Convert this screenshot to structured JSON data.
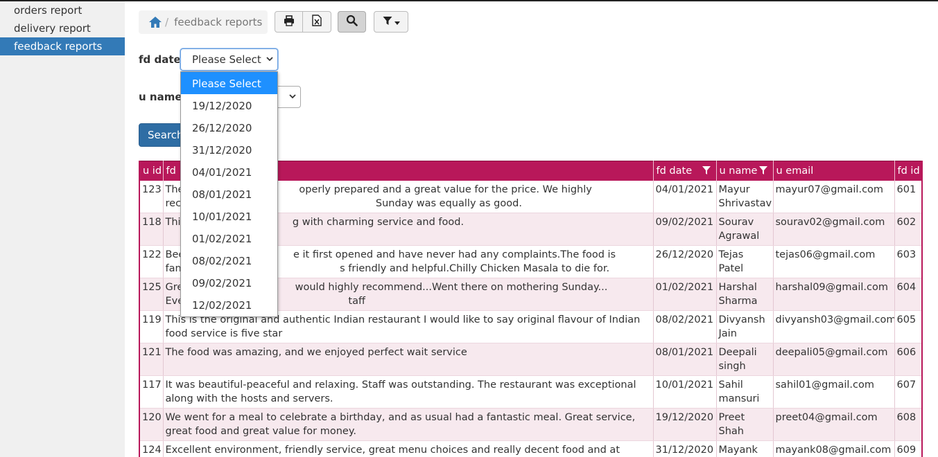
{
  "sidebar": {
    "items": [
      {
        "label": "orders report"
      },
      {
        "label": "delivery report"
      },
      {
        "label": "feedback reports"
      }
    ]
  },
  "breadcrumb": {
    "current": "feedback reports",
    "separator": "/"
  },
  "toolbar": {
    "print_icon": "print-icon",
    "excel_icon": "excel-icon",
    "search_icon": "search-icon",
    "filter_icon": "filter-icon"
  },
  "form": {
    "fd_date_label": "fd date",
    "fd_date_value": "Please Select",
    "u_name_label": "u name",
    "search_button": "Search"
  },
  "dropdown": {
    "options": [
      "Please Select",
      "19/12/2020",
      "26/12/2020",
      "31/12/2020",
      "04/01/2021",
      "08/01/2021",
      "10/01/2021",
      "01/02/2021",
      "08/02/2021",
      "09/02/2021",
      "12/02/2021"
    ]
  },
  "table": {
    "headers": {
      "uid": "u id",
      "fd": "fd",
      "fd_date": "fd date",
      "u_name": "u name",
      "u_email": "u email",
      "fd_id": "fd id"
    },
    "rows": [
      {
        "uid": "123",
        "fd": "The                                    operly prepared and a great value for the price. We highly recommend it. The                                    Sunday was equally as good.",
        "fd_date": "04/01/2021",
        "u_name": "Mayur Shrivastav",
        "u_email": "mayur07@gmail.com",
        "fd_id": "601"
      },
      {
        "uid": "118",
        "fd": "Thi                                   g with charming service and food.",
        "fd_date": "09/02/2021",
        "u_name": "Sourav Agrawal",
        "u_email": "sourav02@gmail.com",
        "fd_id": "602"
      },
      {
        "uid": "122",
        "fd": "Bee                                  e it first opened and have never had any complaints.The food is fantastic and                                  s friendly and helpful.Chilly Chicken Masala to die for.",
        "fd_date": "26/12/2020",
        "u_name": "Tejas Patel",
        "u_email": "tejas06@gmail.com",
        "fd_id": "603"
      },
      {
        "uid": "125",
        "fd": "Gre                                   would highly recommend...Went there on mothering Sunday... Everything per                                  taff",
        "fd_date": "01/02/2021",
        "u_name": "Harshal Sharma",
        "u_email": "harshal09@gmail.com",
        "fd_id": "604"
      },
      {
        "uid": "119",
        "fd": "This is the original and authentic Indian restaurant I would like to say original flavour of Indian food service is five star",
        "fd_date": "08/02/2021",
        "u_name": "Divyansh Jain",
        "u_email": "divyansh03@gmail.com",
        "fd_id": "605"
      },
      {
        "uid": "121",
        "fd": "The food was amazing, and we enjoyed perfect wait service",
        "fd_date": "08/01/2021",
        "u_name": "Deepali singh",
        "u_email": "deepali05@gmail.com",
        "fd_id": "606"
      },
      {
        "uid": "117",
        "fd": "It was beautiful-peaceful and relaxing. Staff was outstanding. The restaurant was exceptional along with the hosts and servers.",
        "fd_date": "10/01/2021",
        "u_name": "Sahil mansuri",
        "u_email": "sahil01@gmail.com",
        "fd_id": "607"
      },
      {
        "uid": "120",
        "fd": "We went for a meal to celebrate a birthday, and as usual had a fantastic meal. Great service, great food and great value for money.",
        "fd_date": "19/12/2020",
        "u_name": "Preet Shah",
        "u_email": "preet04@gmail.com",
        "fd_id": "608"
      },
      {
        "uid": "124",
        "fd": "Excellent environment, friendly service, great menu choices and really decent food and at",
        "fd_date": "31/12/2020",
        "u_name": "Mayank",
        "u_email": "mayank08@gmail.com",
        "fd_id": "609"
      }
    ]
  },
  "colors": {
    "accent": "#337ab7",
    "header": "#b8185a",
    "selected_option": "#1e90ff"
  }
}
